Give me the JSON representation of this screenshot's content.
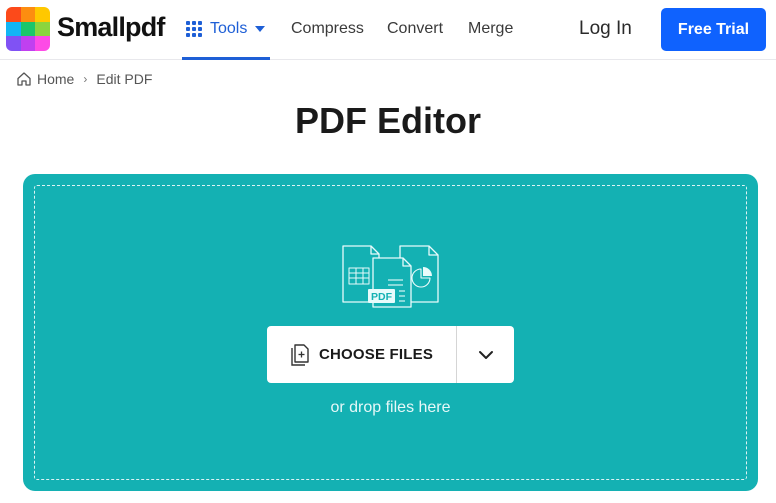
{
  "header": {
    "brand": "Smallpdf",
    "logo_colors": [
      "#fc4a1a",
      "#fd8d10",
      "#ffc800",
      "#12b5f5",
      "#1bc66b",
      "#8ad53e",
      "#8052f4",
      "#c040f0",
      "#fd4be6"
    ],
    "nav": {
      "tools_label": "Tools",
      "compress_label": "Compress",
      "convert_label": "Convert",
      "merge_label": "Merge"
    },
    "login_label": "Log In",
    "trial_label": "Free Trial",
    "accent_color": "#0f62fe"
  },
  "breadcrumb": {
    "home_label": "Home",
    "separator": "›",
    "current_label": "Edit PDF"
  },
  "page": {
    "title": "PDF Editor"
  },
  "dropzone": {
    "background_color": "#14b1b3",
    "illustration_badge": "PDF",
    "choose_label": "CHOOSE FILES",
    "drop_hint": "or drop files here"
  }
}
